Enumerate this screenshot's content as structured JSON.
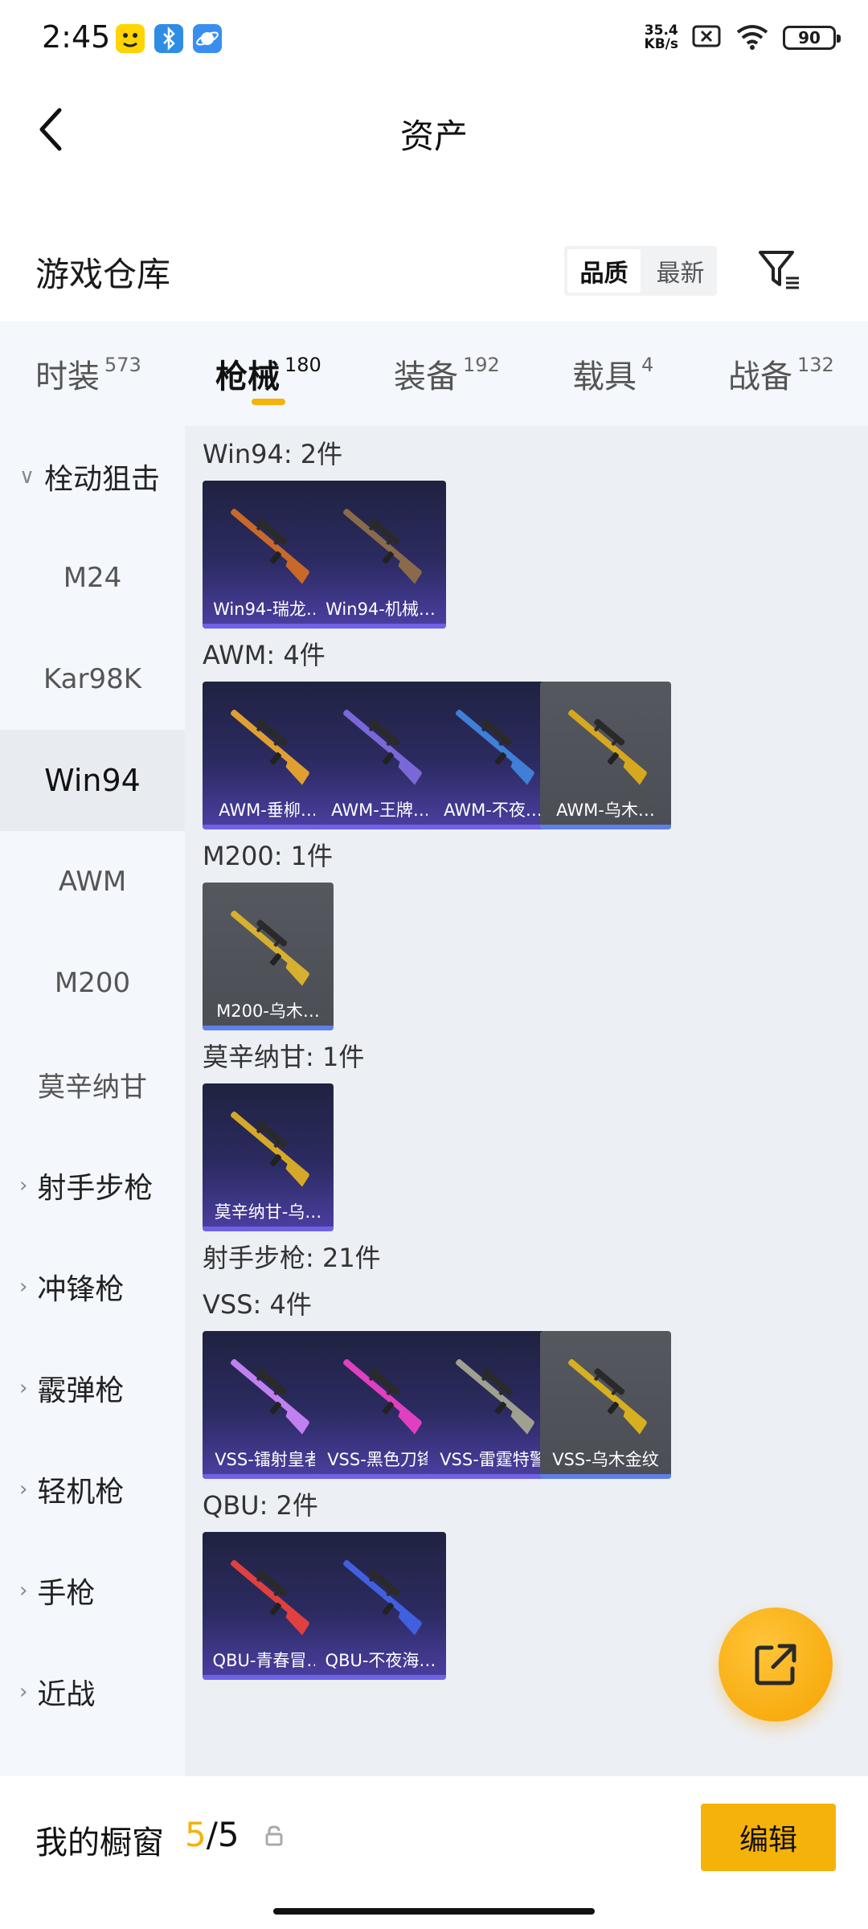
{
  "status_bar": {
    "time": "2:45",
    "net_speed_value": "35.4",
    "net_speed_unit": "KB/s",
    "battery": "90",
    "icons": [
      "gallery-app-icon",
      "bluetooth-icon",
      "planet-app-icon",
      "no-sim-icon",
      "wifi-icon",
      "battery-icon"
    ]
  },
  "header": {
    "title": "资产"
  },
  "warehouse": {
    "title": "游戏仓库",
    "sort_options": [
      "品质",
      "最新"
    ],
    "active_sort": "品质"
  },
  "category_tabs": [
    {
      "label": "时装",
      "count": "573"
    },
    {
      "label": "枪械",
      "count": "180",
      "active": true
    },
    {
      "label": "装备",
      "count": "192"
    },
    {
      "label": "载具",
      "count": "4"
    },
    {
      "label": "战备",
      "count": "132"
    }
  ],
  "sidebar": {
    "items": [
      {
        "label": "栓动狙击",
        "type": "group",
        "expanded": true
      },
      {
        "label": "M24"
      },
      {
        "label": "Kar98K"
      },
      {
        "label": "Win94",
        "selected": true
      },
      {
        "label": "AWM"
      },
      {
        "label": "M200"
      },
      {
        "label": "莫辛纳甘"
      },
      {
        "label": "射手步枪",
        "type": "group"
      },
      {
        "label": "冲锋枪",
        "type": "group"
      },
      {
        "label": "霰弹枪",
        "type": "group"
      },
      {
        "label": "轻机枪",
        "type": "group"
      },
      {
        "label": "手枪",
        "type": "group"
      },
      {
        "label": "近战",
        "type": "group"
      }
    ]
  },
  "sections": [
    {
      "title": "Win94: 2件",
      "items": [
        {
          "label": "Win94-瑞龙…",
          "gun": "#c8692a"
        },
        {
          "label": "Win94-机械…",
          "gun": "#8a6a4a"
        }
      ]
    },
    {
      "title": "AWM: 4件",
      "items": [
        {
          "label": "AWM-垂柳…",
          "gun": "#e0a030"
        },
        {
          "label": "AWM-王牌…",
          "gun": "#7a68d8"
        },
        {
          "label": "AWM-不夜…",
          "gun": "#3f7fd6"
        },
        {
          "label": "AWM-乌木…",
          "gun": "#d6a820",
          "grey": true
        }
      ]
    },
    {
      "title": "M200: 1件",
      "items": [
        {
          "label": "M200-乌木…",
          "gun": "#d6b030",
          "grey": true
        }
      ]
    },
    {
      "title": "莫辛纳甘: 1件",
      "items": [
        {
          "label": "莫辛纳甘-乌…",
          "gun": "#d6a828"
        }
      ]
    },
    {
      "title": "射手步枪: 21件",
      "items": []
    },
    {
      "title": "VSS: 4件",
      "items": [
        {
          "label": "VSS-镭射皇者",
          "gun": "#c080f0"
        },
        {
          "label": "VSS-黑色刀锋",
          "gun": "#e040c0"
        },
        {
          "label": "VSS-雷霆特警",
          "gun": "#a0a090"
        },
        {
          "label": "VSS-乌木金纹",
          "gun": "#d6b020",
          "grey": true
        }
      ]
    },
    {
      "title": "QBU: 2件",
      "items": [
        {
          "label": "QBU-青春冒…",
          "gun": "#e04040"
        },
        {
          "label": "QBU-不夜海…",
          "gun": "#4060e0"
        }
      ]
    }
  ],
  "bottom_bar": {
    "showcase_label": "我的橱窗",
    "showcase_current": "5",
    "showcase_sep": "/",
    "showcase_total": "5",
    "edit_label": "编辑"
  },
  "colors": {
    "accent": "#f5b20a",
    "card_purple": "#2c2b62",
    "card_grey": "#4b4e55"
  }
}
